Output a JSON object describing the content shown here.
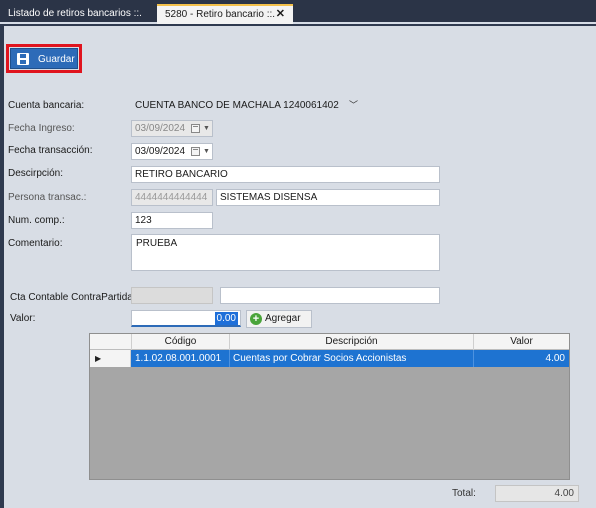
{
  "tabs": [
    {
      "label": "Listado de retiros bancarios ::."
    },
    {
      "label": "5280 - Retiro bancario ::.",
      "close": "✕"
    }
  ],
  "toolbar": {
    "save_label": "Guardar"
  },
  "form": {
    "cuenta_bancaria": {
      "label": "Cuenta bancaria:",
      "value": "CUENTA BANCO DE MACHALA 1240061402"
    },
    "fecha_ingreso": {
      "label": "Fecha Ingreso:",
      "value": "03/09/2024"
    },
    "fecha_transaccion": {
      "label": "Fecha transacción:",
      "value": "03/09/2024"
    },
    "descripcion": {
      "label": "Descirpción:",
      "value": "RETIRO BANCARIO"
    },
    "persona": {
      "label": "Persona transac.:",
      "id_value": "4444444444444",
      "name_value": "SISTEMAS DISENSA"
    },
    "num_comp": {
      "label": "Num. comp.:",
      "value": "123"
    },
    "comentario": {
      "label": "Comentario:",
      "value": "PRUEBA"
    },
    "cta_contable": {
      "label": "Cta Contable ContraPartida:",
      "code_value": "",
      "desc_value": ""
    },
    "valor": {
      "label": "Valor:",
      "value": "0.00"
    },
    "add_label": "Agregar"
  },
  "grid": {
    "columns": [
      "Código",
      "Descripción",
      "Valor"
    ],
    "rows": [
      {
        "indicator": "▶",
        "codigo": "1.1.02.08.001.0001",
        "descripcion": "Cuentas por Cobrar Socios Accionistas",
        "valor": "4.00"
      }
    ]
  },
  "total": {
    "label": "Total:",
    "value": "4.00"
  },
  "colors": {
    "accent": "#1e73d1",
    "highlight": "#e0141e",
    "tab_active_border": "#f3c04a"
  }
}
